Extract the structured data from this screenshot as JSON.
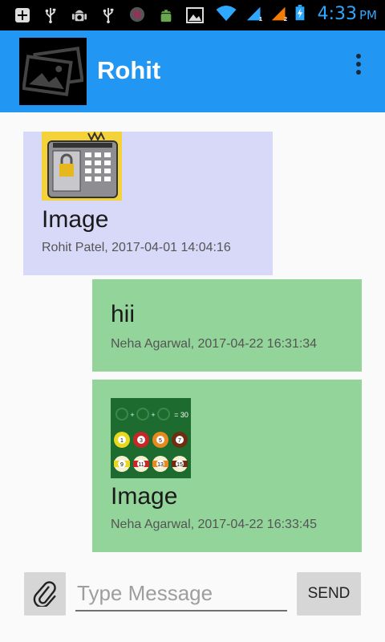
{
  "status_bar": {
    "time": "4:33",
    "ampm": "PM",
    "icons": [
      "add-box-icon",
      "usb-icon",
      "android-debug-icon",
      "usb-icon",
      "notification-n-icon",
      "android-icon",
      "image-icon",
      "wifi-icon",
      "signal-sim1-icon",
      "signal-sim2-icon",
      "battery-charging-icon"
    ],
    "sim1_label": "1",
    "sim2_label": "2"
  },
  "app_bar": {
    "title": "Rohit",
    "avatar_icon": "image-placeholder-icon",
    "menu_icon": "more-vert-icon",
    "color": "#2196f3"
  },
  "messages": [
    {
      "direction": "received",
      "text": "Image",
      "meta": "Rohit Patel, 2017-04-01 14:04:16",
      "has_image": true,
      "image": "lock-keypad-thumbnail",
      "color": "#d8d8f8"
    },
    {
      "direction": "sent",
      "text": "hii",
      "meta": "Neha Agarwal, 2017-04-22 16:31:34",
      "has_image": false,
      "color": "#92d49a"
    },
    {
      "direction": "sent",
      "text": "Image",
      "meta": "Neha Agarwal, 2017-04-22 16:33:45",
      "has_image": true,
      "image": "billiard-balls-puzzle-thumbnail",
      "puzzle_text": "= 30",
      "ball_numbers_top": [
        "1",
        "3",
        "5",
        "7"
      ],
      "ball_numbers_bottom": [
        "9",
        "11",
        "13",
        "15"
      ],
      "color": "#92d49a"
    }
  ],
  "composer": {
    "attach_icon": "paperclip-icon",
    "placeholder": "Type Message",
    "value": "",
    "send_label": "SEND"
  }
}
